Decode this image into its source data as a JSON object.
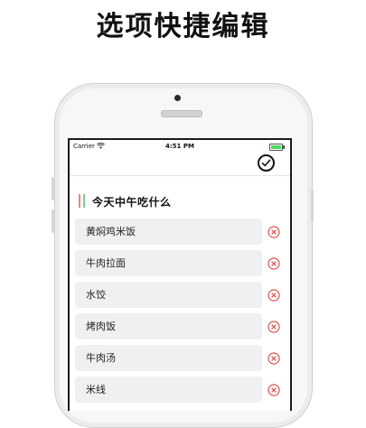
{
  "page_title": "选项快捷编辑",
  "status_bar": {
    "carrier": "Carrier",
    "time": "4:51 PM",
    "wifi_icon": "wifi-icon",
    "battery_icon": "battery-icon"
  },
  "header": {
    "confirm_icon": "checkmark-circle-icon"
  },
  "list": {
    "title": "今天中午吃什么",
    "marker_colors": [
      "#e8867b",
      "#7fc9a3"
    ],
    "delete_icon": "remove-circle-icon",
    "delete_color": "#d9534f",
    "items": [
      {
        "label": "黄焖鸡米饭"
      },
      {
        "label": "牛肉拉面"
      },
      {
        "label": "水饺"
      },
      {
        "label": "烤肉饭"
      },
      {
        "label": "牛肉汤"
      },
      {
        "label": "米线"
      }
    ]
  }
}
